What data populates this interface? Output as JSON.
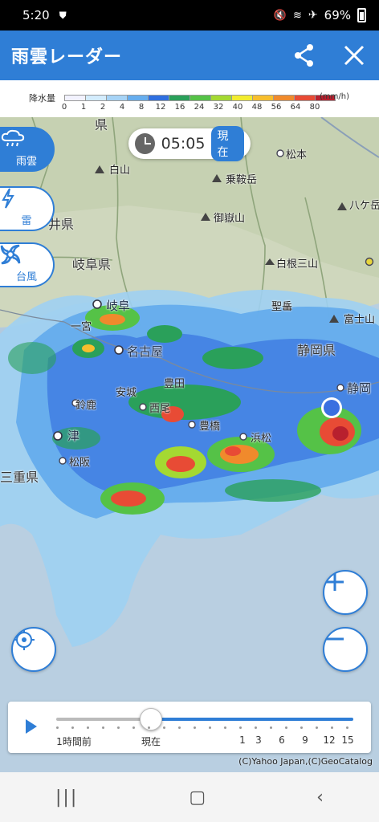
{
  "status": {
    "time": "5:20",
    "battery": "69%"
  },
  "app": {
    "title": "雨雲レーダー"
  },
  "legend": {
    "label": "降水量",
    "unit": "(mm/h)",
    "ticks": [
      "0",
      "1",
      "2",
      "4",
      "8",
      "12",
      "16",
      "24",
      "32",
      "40",
      "48",
      "56",
      "64",
      "80"
    ],
    "colors": [
      "#f2f2ff",
      "#d3ecfd",
      "#a6d3f6",
      "#66adee",
      "#2f6fe0",
      "#2aa05a",
      "#55c247",
      "#a4d932",
      "#f2ec2e",
      "#f7be2d",
      "#f08a2c",
      "#e84b35",
      "#b8202e"
    ]
  },
  "map": {
    "time": "05:05",
    "now_badge": "現在",
    "places": {
      "ken_top": "県",
      "hakusan": "白山",
      "matsumoto": "松本",
      "norikura": "乗鞍岳",
      "yatsugatake": "八ケ岳",
      "ontake": "御嶽山",
      "kenleft": "井県",
      "gifu_ken": "岐阜県",
      "shirane": "白根三山",
      "seidake": "聖岳",
      "fujisan": "富士山",
      "gifu": "岐阜",
      "ichinomiya": "一宮",
      "nagoya": "名古屋",
      "shizuoka_ken": "静岡県",
      "toyota": "豊田",
      "anjo": "安城",
      "shizuoka": "静岡",
      "suzuka": "鈴鹿",
      "nishio": "西尾",
      "toyohashi": "豊橋",
      "hamamatsu": "浜松",
      "tsu": "津",
      "matsusaka": "松阪",
      "mie_ken": "三重県"
    }
  },
  "side_buttons": {
    "rain": "雨雲",
    "thunder": "雷",
    "typhoon": "台風"
  },
  "timeline": {
    "label_past": "1時間前",
    "label_now": "現在",
    "hours": [
      "1",
      "3",
      "6",
      "9",
      "12",
      "15"
    ],
    "position_fraction": 0.28
  },
  "credit": "(C)Yahoo Japan,(C)GeoCatalog"
}
